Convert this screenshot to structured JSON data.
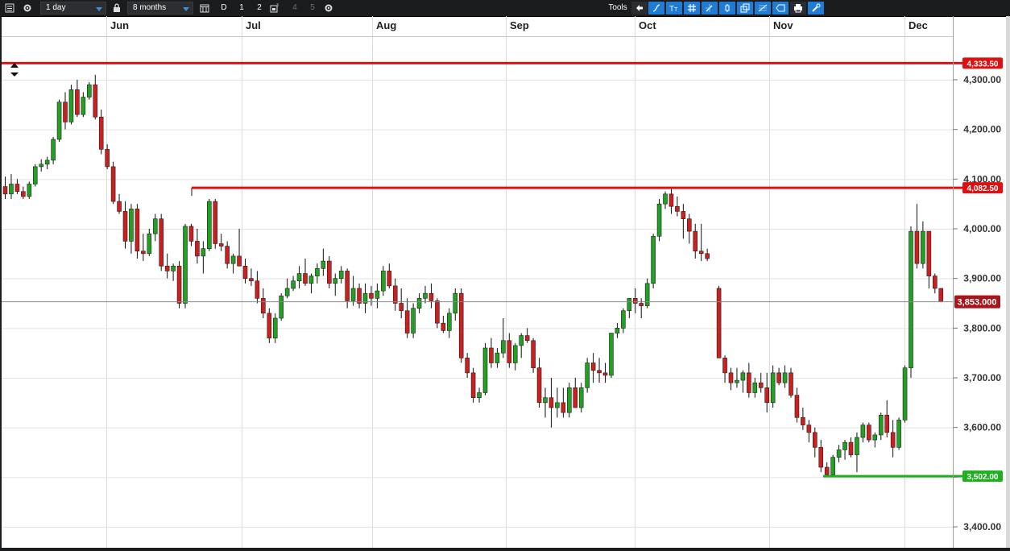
{
  "toolbar": {
    "interval": "1 day",
    "range": "8 months",
    "buttons": [
      "D",
      "1",
      "2"
    ],
    "disabled": [
      "4",
      "5"
    ],
    "tools_label": "Tools",
    "tool_icons": [
      "back-arrow-icon",
      "curve-icon",
      "text-icon",
      "grid-icon",
      "draw-icon",
      "candle-icon",
      "layers-icon",
      "fibonacci-icon",
      "shape-icon",
      "print-icon",
      "settings-tool-icon"
    ]
  },
  "chart_data": {
    "type": "candlestick",
    "x_ticks": [
      "Jun",
      "Jul",
      "Aug",
      "Sep",
      "Oct",
      "Nov",
      "Dec"
    ],
    "y_ticks": [
      "4,300.00",
      "4,200.00",
      "4,100.00",
      "4,000.00",
      "3,900.00",
      "3,800.00",
      "3,700.00",
      "3,600.00",
      "3,500.00",
      "3,400.00"
    ],
    "y_values": [
      4300,
      4200,
      4100,
      4000,
      3900,
      3800,
      3700,
      3600,
      3500,
      3400
    ],
    "ylim": [
      3380,
      4390
    ],
    "grid": true,
    "up_color": "#22a022",
    "down_color": "#cc1f1f",
    "current_price": {
      "value": 3853,
      "label": "3,853.000"
    },
    "horizontal_lines": [
      {
        "value": 4333.5,
        "label": "4,333.50",
        "color": "#e01010"
      },
      {
        "value": 4082.5,
        "label": "4,082.50",
        "color": "#e01010"
      },
      {
        "value": 3502,
        "label": "3,502.00",
        "color": "#1eb01e"
      }
    ],
    "candles": [
      [
        4085,
        4105,
        4060,
        4070
      ],
      [
        4070,
        4110,
        4060,
        4090
      ],
      [
        4090,
        4100,
        4070,
        4075
      ],
      [
        4075,
        4085,
        4060,
        4065
      ],
      [
        4065,
        4095,
        4060,
        4090
      ],
      [
        4090,
        4130,
        4085,
        4125
      ],
      [
        4125,
        4140,
        4115,
        4130
      ],
      [
        4130,
        4145,
        4120,
        4138
      ],
      [
        4138,
        4185,
        4130,
        4180
      ],
      [
        4180,
        4260,
        4175,
        4255
      ],
      [
        4255,
        4275,
        4200,
        4215
      ],
      [
        4215,
        4290,
        4210,
        4280
      ],
      [
        4280,
        4300,
        4225,
        4230
      ],
      [
        4230,
        4275,
        4225,
        4265
      ],
      [
        4265,
        4295,
        4260,
        4290
      ],
      [
        4290,
        4310,
        4220,
        4225
      ],
      [
        4225,
        4240,
        4150,
        4160
      ],
      [
        4160,
        4170,
        4120,
        4125
      ],
      [
        4125,
        4135,
        4050,
        4055
      ],
      [
        4055,
        4070,
        4030,
        4035
      ],
      [
        4035,
        4055,
        3960,
        3975
      ],
      [
        3975,
        4050,
        3950,
        4040
      ],
      [
        4040,
        4050,
        3940,
        3955
      ],
      [
        3955,
        3990,
        3935,
        3950
      ],
      [
        3950,
        4000,
        3945,
        3990
      ],
      [
        3990,
        4030,
        3975,
        4020
      ],
      [
        4020,
        4030,
        3915,
        3925
      ],
      [
        3925,
        3950,
        3900,
        3915
      ],
      [
        3915,
        3930,
        3895,
        3925
      ],
      [
        3925,
        3935,
        3840,
        3850
      ],
      [
        3850,
        4010,
        3840,
        4005
      ],
      [
        4005,
        4010,
        3965,
        3975
      ],
      [
        3975,
        4000,
        3930,
        3945
      ],
      [
        3945,
        3975,
        3910,
        3960
      ],
      [
        3960,
        4060,
        3955,
        4055
      ],
      [
        4055,
        4060,
        3960,
        3970
      ],
      [
        3970,
        3990,
        3955,
        3965
      ],
      [
        3965,
        3975,
        3920,
        3930
      ],
      [
        3930,
        3950,
        3910,
        3945
      ],
      [
        3945,
        4000,
        3930,
        3925
      ],
      [
        3925,
        3940,
        3890,
        3900
      ],
      [
        3900,
        3920,
        3885,
        3895
      ],
      [
        3895,
        3915,
        3850,
        3860
      ],
      [
        3860,
        3880,
        3820,
        3830
      ],
      [
        3830,
        3840,
        3770,
        3780
      ],
      [
        3780,
        3830,
        3770,
        3820
      ],
      [
        3820,
        3870,
        3815,
        3865
      ],
      [
        3865,
        3900,
        3860,
        3880
      ],
      [
        3880,
        3905,
        3875,
        3895
      ],
      [
        3895,
        3925,
        3880,
        3910
      ],
      [
        3910,
        3940,
        3885,
        3890
      ],
      [
        3890,
        3910,
        3870,
        3905
      ],
      [
        3905,
        3930,
        3890,
        3920
      ],
      [
        3920,
        3960,
        3905,
        3935
      ],
      [
        3935,
        3945,
        3880,
        3890
      ],
      [
        3890,
        3910,
        3865,
        3900
      ],
      [
        3900,
        3925,
        3890,
        3915
      ],
      [
        3915,
        3920,
        3840,
        3855
      ],
      [
        3855,
        3905,
        3845,
        3880
      ],
      [
        3880,
        3890,
        3840,
        3850
      ],
      [
        3850,
        3890,
        3830,
        3870
      ],
      [
        3870,
        3885,
        3845,
        3860
      ],
      [
        3860,
        3890,
        3840,
        3875
      ],
      [
        3875,
        3925,
        3865,
        3915
      ],
      [
        3915,
        3930,
        3880,
        3885
      ],
      [
        3885,
        3900,
        3835,
        3850
      ],
      [
        3850,
        3880,
        3820,
        3835
      ],
      [
        3835,
        3860,
        3780,
        3790
      ],
      [
        3790,
        3850,
        3780,
        3840
      ],
      [
        3840,
        3870,
        3830,
        3860
      ],
      [
        3860,
        3885,
        3850,
        3870
      ],
      [
        3870,
        3890,
        3840,
        3855
      ],
      [
        3855,
        3860,
        3800,
        3810
      ],
      [
        3810,
        3825,
        3790,
        3795
      ],
      [
        3795,
        3840,
        3780,
        3830
      ],
      [
        3830,
        3880,
        3815,
        3870
      ],
      [
        3870,
        3880,
        3730,
        3740
      ],
      [
        3740,
        3750,
        3700,
        3710
      ],
      [
        3710,
        3720,
        3650,
        3660
      ],
      [
        3660,
        3680,
        3650,
        3670
      ],
      [
        3670,
        3770,
        3665,
        3760
      ],
      [
        3760,
        3780,
        3720,
        3730
      ],
      [
        3730,
        3760,
        3720,
        3750
      ],
      [
        3750,
        3820,
        3740,
        3775
      ],
      [
        3775,
        3790,
        3720,
        3730
      ],
      [
        3730,
        3770,
        3715,
        3765
      ],
      [
        3765,
        3790,
        3740,
        3785
      ],
      [
        3785,
        3800,
        3770,
        3775
      ],
      [
        3775,
        3780,
        3710,
        3720
      ],
      [
        3720,
        3740,
        3640,
        3650
      ],
      [
        3650,
        3680,
        3620,
        3660
      ],
      [
        3660,
        3700,
        3600,
        3640
      ],
      [
        3640,
        3680,
        3620,
        3650
      ],
      [
        3650,
        3680,
        3620,
        3630
      ],
      [
        3630,
        3690,
        3620,
        3680
      ],
      [
        3680,
        3700,
        3640,
        3640
      ],
      [
        3640,
        3690,
        3630,
        3680
      ],
      [
        3680,
        3740,
        3670,
        3730
      ],
      [
        3730,
        3750,
        3690,
        3715
      ],
      [
        3715,
        3740,
        3690,
        3710
      ],
      [
        3710,
        3730,
        3690,
        3705
      ],
      [
        3705,
        3790,
        3700,
        3790
      ],
      [
        3790,
        3810,
        3780,
        3800
      ],
      [
        3800,
        3840,
        3790,
        3835
      ],
      [
        3835,
        3860,
        3820,
        3860
      ],
      [
        3860,
        3880,
        3830,
        3850
      ],
      [
        3850,
        3860,
        3820,
        3845
      ],
      [
        3845,
        3900,
        3840,
        3890
      ],
      [
        3890,
        3990,
        3880,
        3985
      ],
      [
        3985,
        4060,
        3975,
        4050
      ],
      [
        4050,
        4075,
        4040,
        4070
      ],
      [
        4070,
        4080,
        4030,
        4045
      ],
      [
        4045,
        4065,
        4025,
        4035
      ],
      [
        4035,
        4050,
        3980,
        4020
      ],
      [
        4020,
        4030,
        3970,
        3995
      ],
      [
        3995,
        4010,
        3940,
        3955
      ],
      [
        3955,
        4010,
        3935,
        3950
      ],
      [
        3950,
        3960,
        3935,
        3940
      ],
      [
        3880,
        3885,
        3740,
        3740
      ],
      [
        3740,
        3745,
        3690,
        3710
      ],
      [
        3710,
        3720,
        3675,
        3690
      ],
      [
        3690,
        3720,
        3680,
        3695
      ],
      [
        3695,
        3715,
        3670,
        3710
      ],
      [
        3710,
        3730,
        3660,
        3670
      ],
      [
        3670,
        3700,
        3660,
        3690
      ],
      [
        3690,
        3710,
        3670,
        3680
      ],
      [
        3680,
        3710,
        3630,
        3650
      ],
      [
        3650,
        3725,
        3640,
        3710
      ],
      [
        3710,
        3720,
        3685,
        3690
      ],
      [
        3690,
        3725,
        3680,
        3710
      ],
      [
        3710,
        3720,
        3660,
        3665
      ],
      [
        3665,
        3680,
        3610,
        3620
      ],
      [
        3620,
        3640,
        3595,
        3605
      ],
      [
        3605,
        3615,
        3570,
        3590
      ],
      [
        3590,
        3600,
        3540,
        3560
      ],
      [
        3560,
        3575,
        3510,
        3520
      ],
      [
        3520,
        3530,
        3502,
        3505
      ],
      [
        3505,
        3545,
        3502,
        3540
      ],
      [
        3540,
        3565,
        3530,
        3555
      ],
      [
        3555,
        3575,
        3535,
        3570
      ],
      [
        3570,
        3580,
        3540,
        3545
      ],
      [
        3545,
        3590,
        3510,
        3580
      ],
      [
        3580,
        3610,
        3570,
        3605
      ],
      [
        3605,
        3610,
        3570,
        3575
      ],
      [
        3575,
        3590,
        3560,
        3585
      ],
      [
        3585,
        3630,
        3575,
        3625
      ],
      [
        3625,
        3655,
        3580,
        3590
      ],
      [
        3590,
        3615,
        3540,
        3560
      ],
      [
        3560,
        3620,
        3555,
        3615
      ],
      [
        3615,
        3725,
        3610,
        3720
      ],
      [
        3720,
        4005,
        3700,
        3995
      ],
      [
        3995,
        4050,
        3920,
        3930
      ],
      [
        3930,
        4015,
        3920,
        3995
      ],
      [
        3995,
        3995,
        3880,
        3905
      ],
      [
        3905,
        3910,
        3870,
        3880
      ],
      [
        3880,
        3880,
        3855,
        3853
      ]
    ],
    "gap_after_index": 117
  }
}
